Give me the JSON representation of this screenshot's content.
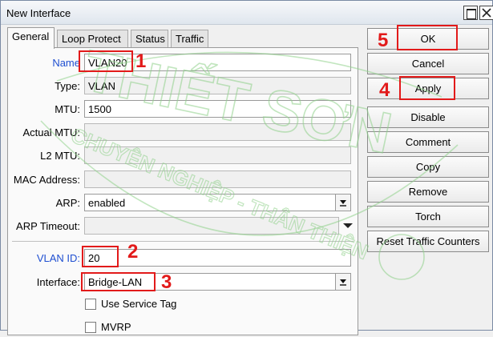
{
  "window": {
    "title": "New Interface"
  },
  "tabs": [
    {
      "label": "General",
      "active": true
    },
    {
      "label": "Loop Protect",
      "active": false
    },
    {
      "label": "Status",
      "active": false
    },
    {
      "label": "Traffic",
      "active": false
    }
  ],
  "form": {
    "name_label": "Name",
    "name_value": "VLAN20",
    "type_label": "Type:",
    "type_value": "VLAN",
    "mtu_label": "MTU:",
    "mtu_value": "1500",
    "actual_mtu_label": "Actual MTU:",
    "actual_mtu_value": "",
    "l2mtu_label": "L2 MTU:",
    "l2mtu_value": "",
    "mac_label": "MAC Address:",
    "mac_value": "",
    "arp_label": "ARP:",
    "arp_value": "enabled",
    "arp_timeout_label": "ARP Timeout:",
    "arp_timeout_value": "",
    "vlan_id_label": "VLAN ID:",
    "vlan_id_value": "20",
    "interface_label": "Interface:",
    "interface_value": "Bridge-LAN",
    "use_service_tag_label": "Use Service Tag",
    "use_service_tag_checked": false,
    "mvrp_label": "MVRP",
    "mvrp_checked": false
  },
  "buttons": {
    "ok": "OK",
    "cancel": "Cancel",
    "apply": "Apply",
    "disable": "Disable",
    "comment": "Comment",
    "copy": "Copy",
    "remove": "Remove",
    "torch": "Torch",
    "reset_traffic": "Reset Traffic Counters"
  },
  "annotations": {
    "n1": "1",
    "n2": "2",
    "n3": "3",
    "n4": "4",
    "n5": "5",
    "color": "#e21a1a"
  },
  "watermark": {
    "line1": "THIẾT SƠN",
    "line2": "CHUYÊN NGHIỆP - THÂN THIỆN",
    "color": "#8fd18a"
  },
  "colors": {
    "label_blue": "#1f4fd1",
    "panel_bg": "#fafafa",
    "window_bg": "#f0f0f0"
  }
}
